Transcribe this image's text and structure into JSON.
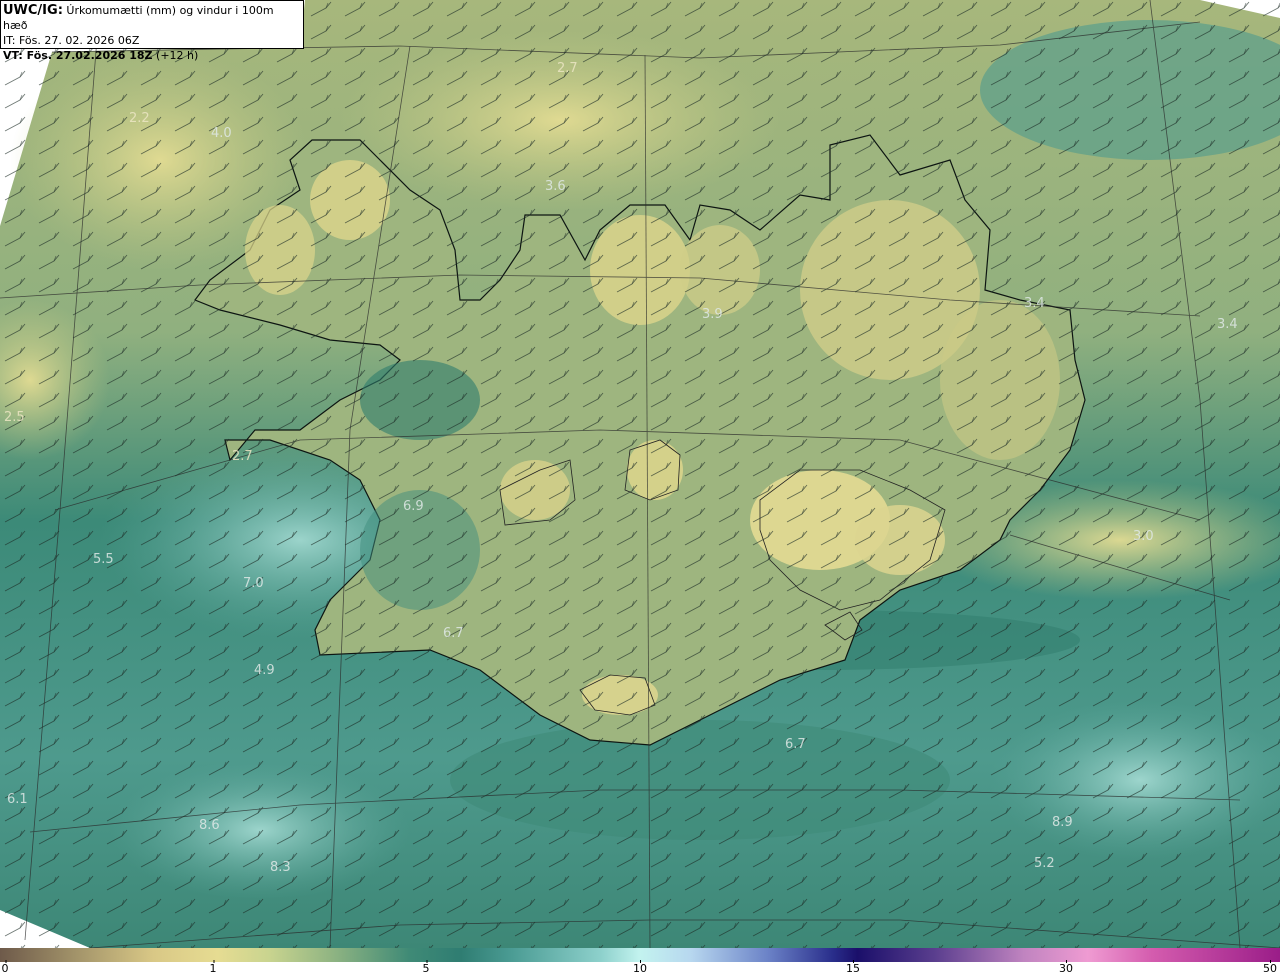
{
  "header": {
    "source_label": "UWC/IG:",
    "title": "Úrkomumætti (mm) og vindur i 100m hæð",
    "init_time": "IT: Fös. 27. 02. 2026 06Z",
    "valid_prefix": "VT: Fös. 27.02.2026 18Z",
    "valid_suffix": "(+12 h)"
  },
  "map_values": [
    {
      "id": "v1",
      "text": "2.7"
    },
    {
      "id": "v2",
      "text": "2.2"
    },
    {
      "id": "v3",
      "text": "4.0"
    },
    {
      "id": "v4",
      "text": "3.6"
    },
    {
      "id": "v5",
      "text": "3.9"
    },
    {
      "id": "v6",
      "text": "3.4"
    },
    {
      "id": "v7",
      "text": "3.4"
    },
    {
      "id": "v8",
      "text": "2.5"
    },
    {
      "id": "v9",
      "text": "2.7"
    },
    {
      "id": "v10",
      "text": "6.9"
    },
    {
      "id": "v11",
      "text": "5.5"
    },
    {
      "id": "v12",
      "text": "7.0"
    },
    {
      "id": "v13",
      "text": "6.7"
    },
    {
      "id": "v14",
      "text": "4.9"
    },
    {
      "id": "v15",
      "text": "3.0"
    },
    {
      "id": "v16",
      "text": "6.7"
    },
    {
      "id": "v17",
      "text": "6.1"
    },
    {
      "id": "v18",
      "text": "8.6"
    },
    {
      "id": "v19",
      "text": "8.3"
    },
    {
      "id": "v20",
      "text": "8.9"
    },
    {
      "id": "v21",
      "text": "5.2"
    }
  ],
  "colorbar": {
    "ticks": [
      "0",
      "1",
      "5",
      "10",
      "15",
      "30",
      "50"
    ],
    "colors": {
      "low": "#6e5a4a",
      "dry": "#e6dc92",
      "moist": "#2f7d72",
      "wet": "#c3f3ef",
      "heavy": "#1a0f6a",
      "extreme": "#9a1d88"
    }
  },
  "map_colors": {
    "ocean_low": "#3f8a76",
    "ocean_high": "#6fb7ac",
    "land_dry": "#d8d48c",
    "coast": "#000000"
  }
}
